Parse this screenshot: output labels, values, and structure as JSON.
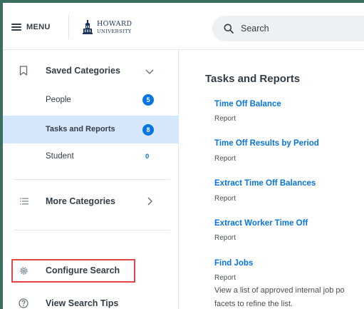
{
  "header": {
    "menu_label": "MENU",
    "logo_line1": "HOWARD",
    "logo_line2": "UNIVERSITY",
    "search_placeholder": "Search"
  },
  "left_panel": {
    "saved_categories": {
      "title": "Saved Categories",
      "items": [
        {
          "label": "People",
          "count": "5",
          "selected": false
        },
        {
          "label": "Tasks and Reports",
          "count": "8",
          "selected": true
        },
        {
          "label": "Student",
          "count": "0",
          "selected": false
        }
      ]
    },
    "more_categories": "More Categories",
    "configure_search": "Configure Search",
    "view_search_tips": "View Search Tips"
  },
  "content": {
    "title": "Tasks and Reports",
    "results": [
      {
        "title": "Time Off Balance",
        "type": "Report"
      },
      {
        "title": "Time Off Results by Period",
        "type": "Report"
      },
      {
        "title": "Extract Time Off Balances",
        "type": "Report"
      },
      {
        "title": "Extract Worker Time Off",
        "type": "Report"
      },
      {
        "title": "Find Jobs",
        "type": "Report",
        "description_line1": "View a list of approved internal job po",
        "description_line2": "facets to refine the list."
      }
    ]
  },
  "colors": {
    "accent": "#0875e1",
    "selected_bg": "#d5e8fb",
    "highlight": "#e04646",
    "background": "#3b6e60",
    "text": "#333d47"
  }
}
